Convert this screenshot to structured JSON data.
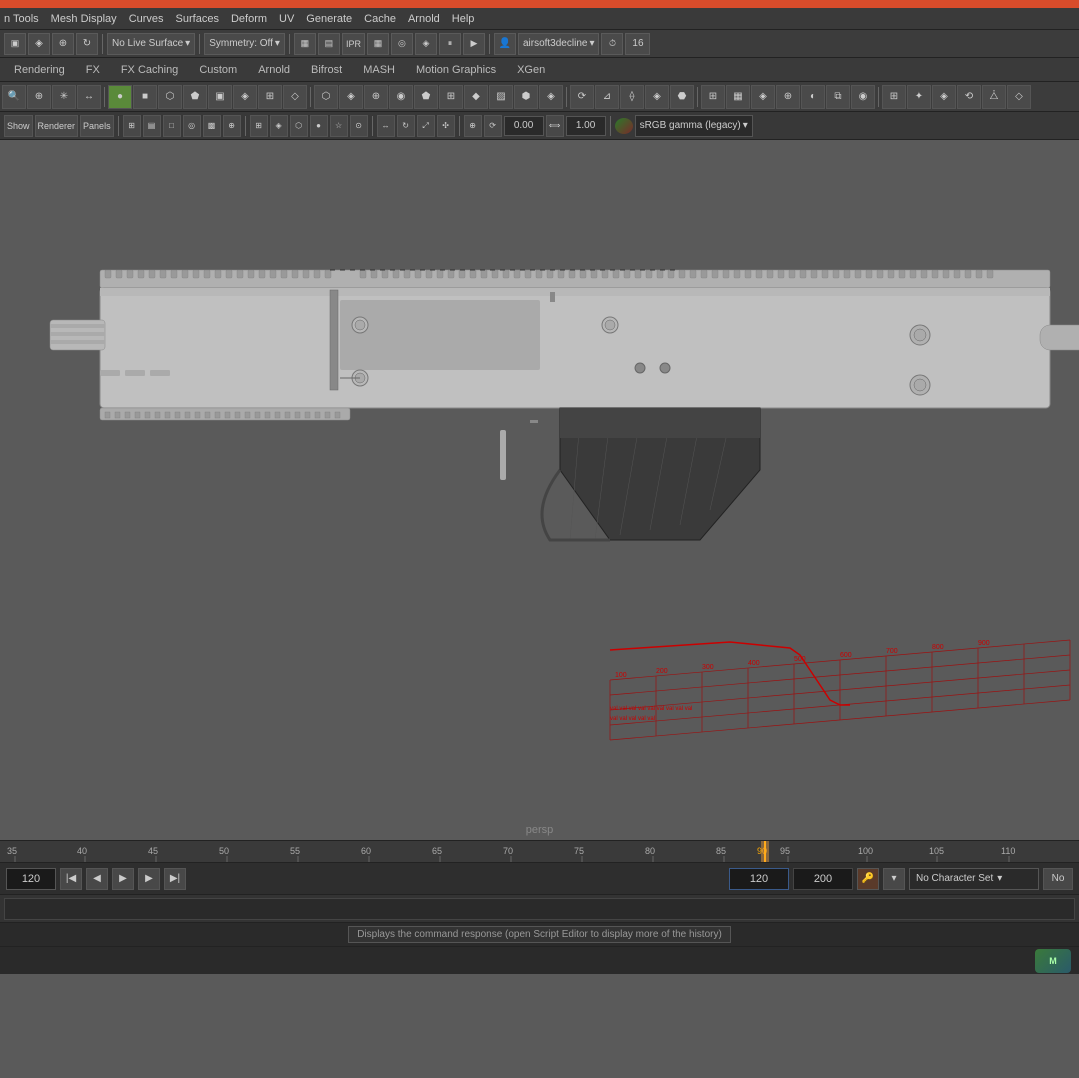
{
  "titlebar": {
    "color": "#d94c2b"
  },
  "menubar": {
    "items": [
      "n Tools",
      "Mesh Display",
      "Curves",
      "Surfaces",
      "Deform",
      "UV",
      "Generate",
      "Cache",
      "Arnold",
      "Help"
    ]
  },
  "toolbar1": {
    "no_live_surface": "No Live Surface",
    "symmetry": "Symmetry: Off",
    "user": "airsoft3decline",
    "time": "16"
  },
  "tabs": {
    "items": [
      "Rendering",
      "FX",
      "FX Caching",
      "Custom",
      "Arnold",
      "Bifrost",
      "MASH",
      "Motion Graphics",
      "XGen"
    ]
  },
  "viewtoolbar": {
    "show": "Show",
    "renderer": "Renderer",
    "panels": "Panels",
    "val1": "0.00",
    "val2": "1.00",
    "color_space": "sRGB gamma (legacy)"
  },
  "viewport": {
    "label": "persp"
  },
  "timeline": {
    "marks": [
      "35",
      "40",
      "45",
      "50",
      "55",
      "60",
      "65",
      "70",
      "75",
      "80",
      "85",
      "90",
      "95",
      "100",
      "105",
      "110"
    ],
    "current_frame": "91",
    "start_frame": "120",
    "end_frame": "200",
    "playback_start": "120",
    "playback_end": "200"
  },
  "playback": {
    "frame_input": "120",
    "start_input": "120",
    "end_input": "200"
  },
  "char_set": {
    "label": "No Character Set",
    "label2": "No"
  },
  "cmd_bar": {
    "text": "Displays the command response (open Script Editor to display more of the history)"
  },
  "icons": {
    "gear": "⚙",
    "search": "🔍",
    "play": "▶",
    "prev": "◀",
    "next": "▶",
    "chevron": "▾",
    "camera": "📷",
    "clock": "🕐"
  }
}
